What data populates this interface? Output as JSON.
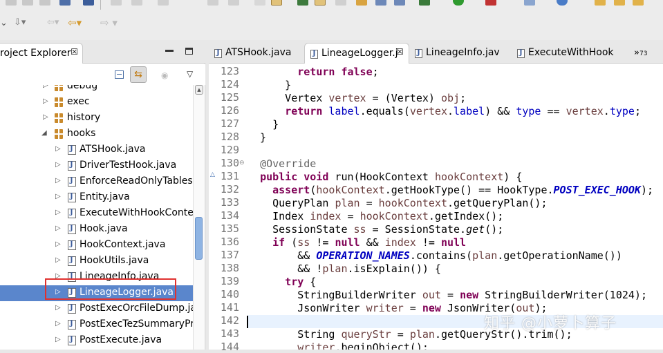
{
  "left_panel": {
    "tab_title": "roject Explorer",
    "tab_close": "☒",
    "tree": [
      {
        "label": "debug",
        "kind": "package",
        "expanded": false,
        "level": 1
      },
      {
        "label": "exec",
        "kind": "package",
        "expanded": false,
        "level": 1
      },
      {
        "label": "history",
        "kind": "package",
        "expanded": false,
        "level": 1
      },
      {
        "label": "hooks",
        "kind": "package",
        "expanded": true,
        "level": 1
      },
      {
        "label": "ATSHook.java",
        "kind": "java",
        "level": 2
      },
      {
        "label": "DriverTestHook.java",
        "kind": "java",
        "level": 2
      },
      {
        "label": "EnforceReadOnlyTables.j",
        "kind": "java",
        "level": 2
      },
      {
        "label": "Entity.java",
        "kind": "java",
        "level": 2
      },
      {
        "label": "ExecuteWithHookContex",
        "kind": "java",
        "level": 2
      },
      {
        "label": "Hook.java",
        "kind": "java",
        "level": 2
      },
      {
        "label": "HookContext.java",
        "kind": "java",
        "level": 2
      },
      {
        "label": "HookUtils.java",
        "kind": "java",
        "level": 2
      },
      {
        "label": "LineageInfo.java",
        "kind": "java",
        "level": 2
      },
      {
        "label": "LineageLogger.java",
        "kind": "java",
        "level": 2,
        "selected": true
      },
      {
        "label": "PostExecOrcFileDump.ja",
        "kind": "java",
        "level": 2
      },
      {
        "label": "PostExecTezSummaryPri",
        "kind": "java",
        "level": 2
      },
      {
        "label": "PostExecute.java",
        "kind": "java",
        "level": 2
      }
    ]
  },
  "editor": {
    "tabs": [
      {
        "label": "ATSHook.java",
        "active": false
      },
      {
        "label": "LineageLogger.j",
        "active": true
      },
      {
        "label": "LineageInfo.jav",
        "active": false
      },
      {
        "label": "ExecuteWithHook",
        "active": false
      }
    ],
    "overflow_label": "»",
    "overflow_count": "73",
    "line_numbers": [
      "123",
      "124",
      "125",
      "126",
      "127",
      "128",
      "129",
      "130",
      "131",
      "132",
      "133",
      "134",
      "135",
      "136",
      "137",
      "138",
      "139",
      "140",
      "141",
      "142",
      "143",
      "144"
    ]
  },
  "watermark": "知乎 @小萝卜算子",
  "colors": {
    "selection": "#5a86cc",
    "keyword": "#7f0055",
    "field": "#0000c0",
    "highlight_box": "#e0312f"
  }
}
